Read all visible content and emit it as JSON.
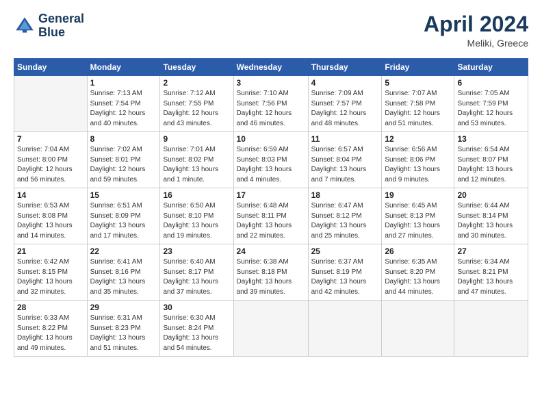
{
  "header": {
    "logo_line1": "General",
    "logo_line2": "Blue",
    "month": "April 2024",
    "location": "Meliki, Greece"
  },
  "days_of_week": [
    "Sunday",
    "Monday",
    "Tuesday",
    "Wednesday",
    "Thursday",
    "Friday",
    "Saturday"
  ],
  "weeks": [
    [
      {
        "day": "",
        "info": ""
      },
      {
        "day": "1",
        "info": "Sunrise: 7:13 AM\nSunset: 7:54 PM\nDaylight: 12 hours\nand 40 minutes."
      },
      {
        "day": "2",
        "info": "Sunrise: 7:12 AM\nSunset: 7:55 PM\nDaylight: 12 hours\nand 43 minutes."
      },
      {
        "day": "3",
        "info": "Sunrise: 7:10 AM\nSunset: 7:56 PM\nDaylight: 12 hours\nand 46 minutes."
      },
      {
        "day": "4",
        "info": "Sunrise: 7:09 AM\nSunset: 7:57 PM\nDaylight: 12 hours\nand 48 minutes."
      },
      {
        "day": "5",
        "info": "Sunrise: 7:07 AM\nSunset: 7:58 PM\nDaylight: 12 hours\nand 51 minutes."
      },
      {
        "day": "6",
        "info": "Sunrise: 7:05 AM\nSunset: 7:59 PM\nDaylight: 12 hours\nand 53 minutes."
      }
    ],
    [
      {
        "day": "7",
        "info": "Sunrise: 7:04 AM\nSunset: 8:00 PM\nDaylight: 12 hours\nand 56 minutes."
      },
      {
        "day": "8",
        "info": "Sunrise: 7:02 AM\nSunset: 8:01 PM\nDaylight: 12 hours\nand 59 minutes."
      },
      {
        "day": "9",
        "info": "Sunrise: 7:01 AM\nSunset: 8:02 PM\nDaylight: 13 hours\nand 1 minute."
      },
      {
        "day": "10",
        "info": "Sunrise: 6:59 AM\nSunset: 8:03 PM\nDaylight: 13 hours\nand 4 minutes."
      },
      {
        "day": "11",
        "info": "Sunrise: 6:57 AM\nSunset: 8:04 PM\nDaylight: 13 hours\nand 7 minutes."
      },
      {
        "day": "12",
        "info": "Sunrise: 6:56 AM\nSunset: 8:06 PM\nDaylight: 13 hours\nand 9 minutes."
      },
      {
        "day": "13",
        "info": "Sunrise: 6:54 AM\nSunset: 8:07 PM\nDaylight: 13 hours\nand 12 minutes."
      }
    ],
    [
      {
        "day": "14",
        "info": "Sunrise: 6:53 AM\nSunset: 8:08 PM\nDaylight: 13 hours\nand 14 minutes."
      },
      {
        "day": "15",
        "info": "Sunrise: 6:51 AM\nSunset: 8:09 PM\nDaylight: 13 hours\nand 17 minutes."
      },
      {
        "day": "16",
        "info": "Sunrise: 6:50 AM\nSunset: 8:10 PM\nDaylight: 13 hours\nand 19 minutes."
      },
      {
        "day": "17",
        "info": "Sunrise: 6:48 AM\nSunset: 8:11 PM\nDaylight: 13 hours\nand 22 minutes."
      },
      {
        "day": "18",
        "info": "Sunrise: 6:47 AM\nSunset: 8:12 PM\nDaylight: 13 hours\nand 25 minutes."
      },
      {
        "day": "19",
        "info": "Sunrise: 6:45 AM\nSunset: 8:13 PM\nDaylight: 13 hours\nand 27 minutes."
      },
      {
        "day": "20",
        "info": "Sunrise: 6:44 AM\nSunset: 8:14 PM\nDaylight: 13 hours\nand 30 minutes."
      }
    ],
    [
      {
        "day": "21",
        "info": "Sunrise: 6:42 AM\nSunset: 8:15 PM\nDaylight: 13 hours\nand 32 minutes."
      },
      {
        "day": "22",
        "info": "Sunrise: 6:41 AM\nSunset: 8:16 PM\nDaylight: 13 hours\nand 35 minutes."
      },
      {
        "day": "23",
        "info": "Sunrise: 6:40 AM\nSunset: 8:17 PM\nDaylight: 13 hours\nand 37 minutes."
      },
      {
        "day": "24",
        "info": "Sunrise: 6:38 AM\nSunset: 8:18 PM\nDaylight: 13 hours\nand 39 minutes."
      },
      {
        "day": "25",
        "info": "Sunrise: 6:37 AM\nSunset: 8:19 PM\nDaylight: 13 hours\nand 42 minutes."
      },
      {
        "day": "26",
        "info": "Sunrise: 6:35 AM\nSunset: 8:20 PM\nDaylight: 13 hours\nand 44 minutes."
      },
      {
        "day": "27",
        "info": "Sunrise: 6:34 AM\nSunset: 8:21 PM\nDaylight: 13 hours\nand 47 minutes."
      }
    ],
    [
      {
        "day": "28",
        "info": "Sunrise: 6:33 AM\nSunset: 8:22 PM\nDaylight: 13 hours\nand 49 minutes."
      },
      {
        "day": "29",
        "info": "Sunrise: 6:31 AM\nSunset: 8:23 PM\nDaylight: 13 hours\nand 51 minutes."
      },
      {
        "day": "30",
        "info": "Sunrise: 6:30 AM\nSunset: 8:24 PM\nDaylight: 13 hours\nand 54 minutes."
      },
      {
        "day": "",
        "info": ""
      },
      {
        "day": "",
        "info": ""
      },
      {
        "day": "",
        "info": ""
      },
      {
        "day": "",
        "info": ""
      }
    ]
  ]
}
